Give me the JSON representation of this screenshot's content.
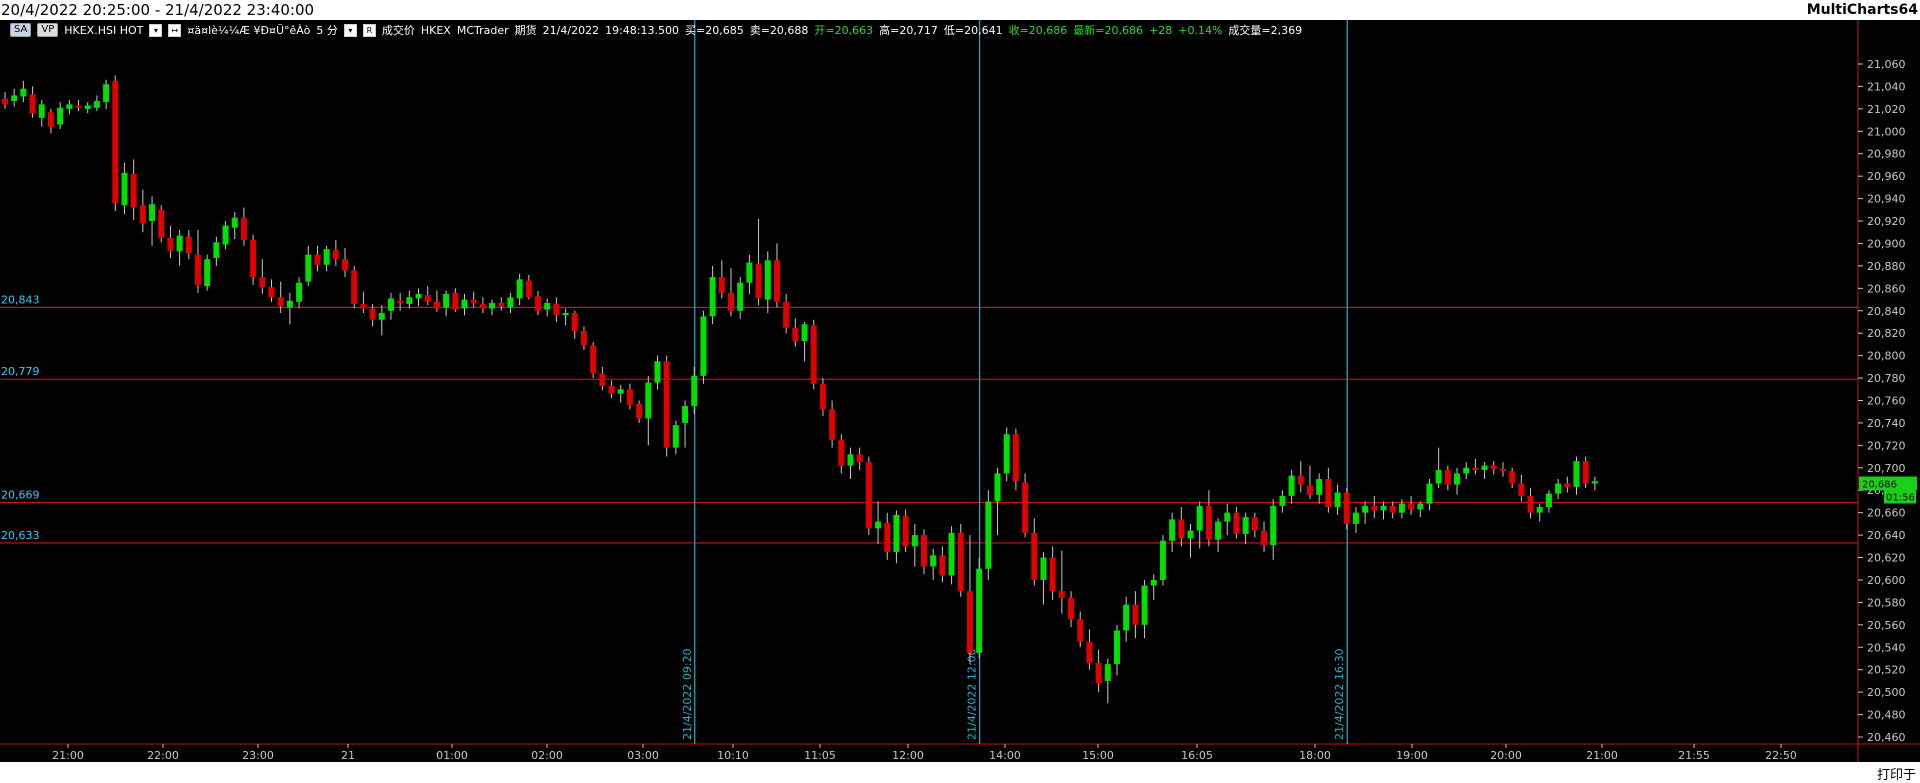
{
  "window": {
    "title": "20/4/2022 20:25:00 - 21/4/2022 23:40:00",
    "app_name": "MultiCharts64",
    "status": "打印于"
  },
  "toolbar": {
    "sa_label": "SA",
    "vp_label": "VP",
    "symbol": "HKEX.HSI HOT",
    "resolution_garbled": "¤ä¤lè¼¼Æ ¥Ð¤Ü°êÀò",
    "interval": "5 分",
    "price_field": "成交价",
    "exchange": "HKEX",
    "datafeed": "MCTrader",
    "market_type": "期货",
    "last_date": "21/4/2022",
    "last_time": "19:48:13.500",
    "buy_quote": "买=20,685",
    "sell_quote": "卖=20,688",
    "open_quote": "开=20,663",
    "high_quote": "高=20,717",
    "low_quote": "低=20,641",
    "close_quote": "收=20,686",
    "last_quote": "最新=20,686",
    "change": "+28",
    "change_pct": "+0.14%",
    "volume_quote": "成交量=2,369"
  },
  "colors": {
    "background": "#000000",
    "up_candle": "#00e000",
    "down_candle": "#e00000",
    "wick": "#c8c8c8",
    "hline": "#d01010",
    "hline_label": "#33ccff",
    "vline": "#19b5c8",
    "axis_text": "#c8c8c8",
    "price_tag_bg": "#19d019"
  },
  "chart_data": {
    "type": "candlestick",
    "title": "",
    "xlabel": "",
    "ylabel": "",
    "y_range": [
      20450,
      21080
    ],
    "y_ticks": [
      21060,
      21040,
      21020,
      21000,
      20980,
      20960,
      20940,
      20920,
      20900,
      20880,
      20860,
      20840,
      20820,
      20800,
      20780,
      20760,
      20740,
      20720,
      20700,
      20680,
      20660,
      20640,
      20620,
      20600,
      20580,
      20560,
      20540,
      20520,
      20500,
      20480,
      20460
    ],
    "y_tick_labels": [
      "21,060",
      "21,040",
      "21,020",
      "21,000",
      "20,980",
      "20,960",
      "20,940",
      "20,920",
      "20,900",
      "20,880",
      "20,860",
      "20,840",
      "20,820",
      "20,800",
      "20,780",
      "20,760",
      "20,740",
      "20,720",
      "20,700",
      "20,680",
      "20,660",
      "20,640",
      "20,620",
      "20,600",
      "20,580",
      "20,560",
      "20,540",
      "20,520",
      "20,500",
      "20,480",
      "20,460"
    ],
    "x_tick_labels": [
      "21:00",
      "22:00",
      "23:00",
      "21",
      "01:00",
      "02:00",
      "03:00",
      "10:10",
      "11:05",
      "12:00",
      "14:00",
      "15:00",
      "16:05",
      "18:00",
      "19:00",
      "20:00",
      "21:00",
      "21:55",
      "22:50"
    ],
    "horizontal_levels": [
      {
        "value": 20843,
        "label": "20,843"
      },
      {
        "value": 20779,
        "label": "20,779"
      },
      {
        "value": 20669,
        "label": "20,669"
      },
      {
        "value": 20633,
        "label": "20,633"
      }
    ],
    "vertical_markers": [
      {
        "bar_index": 75,
        "label": "21/4/2022 09:20"
      },
      {
        "bar_index": 106,
        "label": "21/4/2022 12:00"
      },
      {
        "bar_index": 146,
        "label": "21/4/2022 16:30"
      }
    ],
    "last_price_tag": "20,686",
    "countdown_tag": "01:56",
    "candles": [
      [
        21029,
        21035,
        21020,
        21024
      ],
      [
        21027,
        21038,
        21022,
        21032
      ],
      [
        21031,
        21045,
        21026,
        21038
      ],
      [
        21033,
        21040,
        21012,
        21016
      ],
      [
        21012,
        21028,
        21004,
        21024
      ],
      [
        21017,
        21020,
        20998,
        21004
      ],
      [
        21006,
        21026,
        21002,
        21021
      ],
      [
        21020,
        21028,
        21015,
        21024
      ],
      [
        21023,
        21028,
        21018,
        21021
      ],
      [
        21020,
        21026,
        21016,
        21023
      ],
      [
        21021,
        21032,
        21018,
        21027
      ],
      [
        21026,
        21046,
        21020,
        21042
      ],
      [
        21045,
        21050,
        20929,
        20936
      ],
      [
        20934,
        20972,
        20926,
        20963
      ],
      [
        20962,
        20975,
        20921,
        20932
      ],
      [
        20934,
        20948,
        20910,
        20918
      ],
      [
        20920,
        20942,
        20898,
        20935
      ],
      [
        20930,
        20934,
        20901,
        20905
      ],
      [
        20905,
        20916,
        20887,
        20893
      ],
      [
        20893,
        20912,
        20880,
        20907
      ],
      [
        20906,
        20912,
        20886,
        20891
      ],
      [
        20890,
        20912,
        20856,
        20863
      ],
      [
        20862,
        20890,
        20858,
        20886
      ],
      [
        20887,
        20906,
        20880,
        20901
      ],
      [
        20899,
        20920,
        20895,
        20916
      ],
      [
        20914,
        20928,
        20904,
        20923
      ],
      [
        20923,
        20932,
        20898,
        20903
      ],
      [
        20903,
        20908,
        20863,
        20870
      ],
      [
        20870,
        20886,
        20855,
        20861
      ],
      [
        20861,
        20868,
        20848,
        20852
      ],
      [
        20852,
        20866,
        20838,
        20844
      ],
      [
        20843,
        20856,
        20828,
        20849
      ],
      [
        20848,
        20870,
        20842,
        20865
      ],
      [
        20866,
        20898,
        20862,
        20890
      ],
      [
        20890,
        20898,
        20875,
        20881
      ],
      [
        20881,
        20898,
        20875,
        20895
      ],
      [
        20894,
        20903,
        20880,
        20886
      ],
      [
        20886,
        20896,
        20870,
        20876
      ],
      [
        20876,
        20880,
        20842,
        20846
      ],
      [
        20846,
        20857,
        20838,
        20842
      ],
      [
        20842,
        20846,
        20826,
        20832
      ],
      [
        20832,
        20845,
        20818,
        20838
      ],
      [
        20840,
        20856,
        20832,
        20851
      ],
      [
        20849,
        20856,
        20840,
        20847
      ],
      [
        20846,
        20858,
        20842,
        20852
      ],
      [
        20851,
        20860,
        20844,
        20855
      ],
      [
        20854,
        20862,
        20845,
        20848
      ],
      [
        20848,
        20858,
        20839,
        20842
      ],
      [
        20843,
        20858,
        20835,
        20855
      ],
      [
        20856,
        20860,
        20839,
        20841
      ],
      [
        20842,
        20855,
        20836,
        20850
      ],
      [
        20850,
        20857,
        20843,
        20847
      ],
      [
        20846,
        20852,
        20838,
        20842
      ],
      [
        20842,
        20850,
        20836,
        20847
      ],
      [
        20847,
        20852,
        20840,
        20844
      ],
      [
        20843,
        20856,
        20838,
        20852
      ],
      [
        20851,
        20873,
        20845,
        20868
      ],
      [
        20867,
        20872,
        20850,
        20852
      ],
      [
        20853,
        20858,
        20836,
        20840
      ],
      [
        20841,
        20851,
        20835,
        20847
      ],
      [
        20846,
        20852,
        20830,
        20836
      ],
      [
        20836,
        20842,
        20827,
        20838
      ],
      [
        20838,
        20840,
        20815,
        20822
      ],
      [
        20822,
        20826,
        20805,
        20809
      ],
      [
        20809,
        20812,
        20780,
        20784
      ],
      [
        20784,
        20790,
        20769,
        20773
      ],
      [
        20773,
        20778,
        20762,
        20766
      ],
      [
        20766,
        20774,
        20758,
        20770
      ],
      [
        20770,
        20775,
        20752,
        20756
      ],
      [
        20757,
        20760,
        20740,
        20744
      ],
      [
        20744,
        20782,
        20720,
        20776
      ],
      [
        20776,
        20800,
        20770,
        20795
      ],
      [
        20795,
        20800,
        20710,
        20718
      ],
      [
        20718,
        20742,
        20712,
        20738
      ],
      [
        20740,
        20760,
        20718,
        20755
      ],
      [
        20755,
        20790,
        20748,
        20782
      ],
      [
        20782,
        20840,
        20775,
        20835
      ],
      [
        20835,
        20880,
        20828,
        20870
      ],
      [
        20870,
        20885,
        20851,
        20856
      ],
      [
        20856,
        20878,
        20835,
        20840
      ],
      [
        20840,
        20870,
        20833,
        20865
      ],
      [
        20865,
        20890,
        20855,
        20883
      ],
      [
        20882,
        20922,
        20845,
        20851
      ],
      [
        20850,
        20893,
        20838,
        20885
      ],
      [
        20885,
        20900,
        20843,
        20848
      ],
      [
        20848,
        20855,
        20820,
        20825
      ],
      [
        20825,
        20833,
        20808,
        20813
      ],
      [
        20813,
        20830,
        20795,
        20828
      ],
      [
        20827,
        20832,
        20770,
        20775
      ],
      [
        20775,
        20780,
        20746,
        20752
      ],
      [
        20752,
        20760,
        20718,
        20725
      ],
      [
        20725,
        20730,
        20695,
        20702
      ],
      [
        20702,
        20718,
        20690,
        20712
      ],
      [
        20712,
        20718,
        20698,
        20705
      ],
      [
        20705,
        20710,
        20640,
        20646
      ],
      [
        20646,
        20670,
        20632,
        20652
      ],
      [
        20651,
        20660,
        20618,
        20625
      ],
      [
        20625,
        20662,
        20615,
        20658
      ],
      [
        20657,
        20663,
        20625,
        20630
      ],
      [
        20630,
        20650,
        20612,
        20640
      ],
      [
        20640,
        20645,
        20605,
        20612
      ],
      [
        20612,
        20628,
        20600,
        20622
      ],
      [
        20622,
        20630,
        20598,
        20604
      ],
      [
        20604,
        20648,
        20596,
        20642
      ],
      [
        20642,
        20650,
        20585,
        20590
      ],
      [
        20590,
        20640,
        20525,
        20535
      ],
      [
        20535,
        20620,
        20530,
        20610
      ],
      [
        20610,
        20680,
        20600,
        20670
      ],
      [
        20670,
        20700,
        20640,
        20695
      ],
      [
        20695,
        20736,
        20688,
        20730
      ],
      [
        20730,
        20735,
        20680,
        20688
      ],
      [
        20687,
        20695,
        20638,
        20642
      ],
      [
        20642,
        20655,
        20595,
        20600
      ],
      [
        20600,
        20625,
        20578,
        20620
      ],
      [
        20620,
        20630,
        20582,
        20590
      ],
      [
        20590,
        20626,
        20570,
        20584
      ],
      [
        20584,
        20590,
        20558,
        20565
      ],
      [
        20565,
        20572,
        20540,
        20545
      ],
      [
        20545,
        20556,
        20520,
        20526
      ],
      [
        20526,
        20538,
        20500,
        20508
      ],
      [
        20510,
        20530,
        20490,
        20525
      ],
      [
        20525,
        20560,
        20515,
        20555
      ],
      [
        20555,
        20585,
        20545,
        20578
      ],
      [
        20578,
        20590,
        20548,
        20560
      ],
      [
        20560,
        20600,
        20548,
        20595
      ],
      [
        20595,
        20605,
        20582,
        20600
      ],
      [
        20600,
        20640,
        20595,
        20635
      ],
      [
        20635,
        20660,
        20625,
        20654
      ],
      [
        20654,
        20665,
        20630,
        20637
      ],
      [
        20637,
        20650,
        20620,
        20644
      ],
      [
        20644,
        20670,
        20628,
        20666
      ],
      [
        20666,
        20680,
        20630,
        20636
      ],
      [
        20636,
        20655,
        20625,
        20652
      ],
      [
        20652,
        20668,
        20640,
        20660
      ],
      [
        20660,
        20665,
        20637,
        20641
      ],
      [
        20641,
        20660,
        20632,
        20656
      ],
      [
        20656,
        20660,
        20638,
        20644
      ],
      [
        20644,
        20652,
        20625,
        20631
      ],
      [
        20631,
        20672,
        20618,
        20666
      ],
      [
        20666,
        20680,
        20660,
        20675
      ],
      [
        20675,
        20698,
        20668,
        20693
      ],
      [
        20693,
        20706,
        20678,
        20685
      ],
      [
        20684,
        20702,
        20672,
        20676
      ],
      [
        20676,
        20695,
        20668,
        20690
      ],
      [
        20690,
        20700,
        20660,
        20665
      ],
      [
        20665,
        20685,
        20658,
        20678
      ],
      [
        20678,
        20682,
        20645,
        20650
      ],
      [
        20650,
        20665,
        20642,
        20660
      ],
      [
        20660,
        20670,
        20650,
        20666
      ],
      [
        20666,
        20675,
        20655,
        20662
      ],
      [
        20662,
        20670,
        20654,
        20666
      ],
      [
        20666,
        20670,
        20655,
        20660
      ],
      [
        20660,
        20672,
        20655,
        20668
      ],
      [
        20668,
        20675,
        20658,
        20663
      ],
      [
        20663,
        20670,
        20656,
        20668
      ],
      [
        20668,
        20690,
        20662,
        20686
      ],
      [
        20686,
        20718,
        20682,
        20698
      ],
      [
        20698,
        20702,
        20680,
        20685
      ],
      [
        20685,
        20700,
        20676,
        20695
      ],
      [
        20695,
        20705,
        20690,
        20700
      ],
      [
        20700,
        20708,
        20694,
        20698
      ],
      [
        20698,
        20705,
        20690,
        20702
      ],
      [
        20702,
        20706,
        20694,
        20699
      ],
      [
        20699,
        20705,
        20692,
        20697
      ],
      [
        20697,
        20700,
        20682,
        20686
      ],
      [
        20686,
        20694,
        20670,
        20675
      ],
      [
        20675,
        20682,
        20655,
        20660
      ],
      [
        20660,
        20668,
        20652,
        20665
      ],
      [
        20665,
        20680,
        20660,
        20677
      ],
      [
        20677,
        20690,
        20672,
        20686
      ],
      [
        20686,
        20692,
        20678,
        20683
      ],
      [
        20683,
        20710,
        20676,
        20706
      ],
      [
        20706,
        20710,
        20682,
        20686
      ],
      [
        20686,
        20692,
        20680,
        20688
      ]
    ]
  }
}
